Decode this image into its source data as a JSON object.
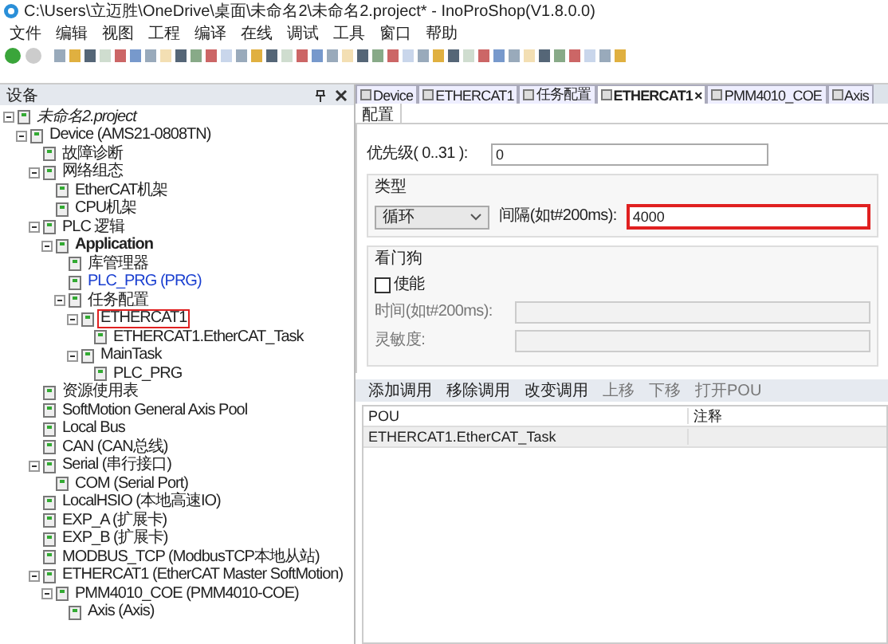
{
  "window": {
    "title": "C:\\Users\\立迈胜\\OneDrive\\桌面\\未命名2\\未命名2.project* - InoProShop(V1.8.0.0)"
  },
  "menu": [
    "文件",
    "编辑",
    "视图",
    "工程",
    "编译",
    "在线",
    "调试",
    "工具",
    "窗口",
    "帮助"
  ],
  "sidebar": {
    "title": "设备",
    "tree": [
      {
        "label": "未命名2.project",
        "kind": "project",
        "expanded": true,
        "highlighted": false,
        "children": [
          {
            "label": "Device (AMS21-0808TN)",
            "kind": "item",
            "expanded": true,
            "highlighted": false,
            "children": [
              {
                "label": "故障诊断",
                "kind": "item",
                "highlighted": false
              },
              {
                "label": "网络组态",
                "kind": "item",
                "expanded": true,
                "highlighted": false,
                "children": [
                  {
                    "label": "EtherCAT机架",
                    "kind": "item",
                    "highlighted": false
                  },
                  {
                    "label": "CPU机架",
                    "kind": "item",
                    "highlighted": false
                  }
                ]
              },
              {
                "label": "PLC 逻辑",
                "kind": "item",
                "expanded": true,
                "highlighted": false,
                "children": [
                  {
                    "label": "Application",
                    "kind": "bold",
                    "expanded": true,
                    "highlighted": false,
                    "children": [
                      {
                        "label": "库管理器",
                        "kind": "item",
                        "highlighted": false
                      },
                      {
                        "label": "PLC_PRG (PRG)",
                        "kind": "link",
                        "highlighted": false
                      },
                      {
                        "label": "任务配置",
                        "kind": "item",
                        "expanded": true,
                        "highlighted": false,
                        "children": [
                          {
                            "label": "ETHERCAT1",
                            "kind": "item",
                            "expanded": true,
                            "highlighted": true,
                            "children": [
                              {
                                "label": "ETHERCAT1.EtherCAT_Task",
                                "kind": "item",
                                "highlighted": false
                              }
                            ]
                          },
                          {
                            "label": "MainTask",
                            "kind": "item",
                            "expanded": true,
                            "highlighted": false,
                            "children": [
                              {
                                "label": "PLC_PRG",
                                "kind": "item",
                                "highlighted": false
                              }
                            ]
                          }
                        ]
                      }
                    ]
                  }
                ]
              },
              {
                "label": "资源使用表",
                "kind": "item",
                "highlighted": false
              },
              {
                "label": "SoftMotion General Axis Pool",
                "kind": "item",
                "highlighted": false
              },
              {
                "label": "Local Bus",
                "kind": "item",
                "highlighted": false
              },
              {
                "label": "CAN (CAN总线)",
                "kind": "item",
                "highlighted": false
              },
              {
                "label": "Serial (串行接口)",
                "kind": "item",
                "expanded": true,
                "highlighted": false,
                "children": [
                  {
                    "label": "COM (Serial Port)",
                    "kind": "item",
                    "highlighted": false
                  }
                ]
              },
              {
                "label": "LocalHSIO (本地高速IO)",
                "kind": "item",
                "highlighted": false
              },
              {
                "label": "EXP_A (扩展卡)",
                "kind": "item",
                "highlighted": false
              },
              {
                "label": "EXP_B (扩展卡)",
                "kind": "item",
                "highlighted": false
              },
              {
                "label": "MODBUS_TCP (ModbusTCP本地从站)",
                "kind": "item",
                "highlighted": false
              },
              {
                "label": "ETHERCAT1 (EtherCAT Master SoftMotion)",
                "kind": "item",
                "expanded": true,
                "highlighted": false,
                "children": [
                  {
                    "label": "PMM4010_COE (PMM4010-COE)",
                    "kind": "item",
                    "expanded": true,
                    "highlighted": false,
                    "children": [
                      {
                        "label": "Axis (Axis)",
                        "kind": "item",
                        "highlighted": false
                      }
                    ]
                  }
                ]
              }
            ]
          }
        ]
      }
    ]
  },
  "tabs": [
    {
      "label": "Device",
      "selected": false
    },
    {
      "label": "ETHERCAT1",
      "selected": false
    },
    {
      "label": "任务配置",
      "selected": false
    },
    {
      "label": "ETHERCAT1",
      "selected": true,
      "close": "×"
    },
    {
      "label": "PMM4010_COE",
      "selected": false
    },
    {
      "label": "Axis",
      "selected": false
    }
  ],
  "subtab": "配置",
  "priority": {
    "label": "优先级( 0..31 ):",
    "value": "0"
  },
  "type_group": {
    "title": "类型",
    "select": "循环",
    "interval": {
      "label": "间隔(如t#200ms):",
      "value": "4000",
      "highlighted": true
    }
  },
  "watchdog": {
    "title": "看门狗",
    "enable": {
      "label": "使能",
      "checked": false
    },
    "fields": [
      {
        "label": "时间(如t#200ms):",
        "disabled": true
      },
      {
        "label": "灵敏度:",
        "disabled": true
      }
    ]
  },
  "call_toolbar": [
    {
      "label": "添加调用",
      "disabled": false
    },
    {
      "label": "移除调用",
      "disabled": false
    },
    {
      "label": "改变调用",
      "disabled": false
    },
    {
      "label": "上移",
      "disabled": true
    },
    {
      "label": "下移",
      "disabled": true
    },
    {
      "label": "打开POU",
      "disabled": true
    }
  ],
  "table": {
    "columns": [
      "POU",
      "注释"
    ],
    "rows": [
      [
        "ETHERCAT1.EtherCAT_Task",
        ""
      ]
    ]
  }
}
